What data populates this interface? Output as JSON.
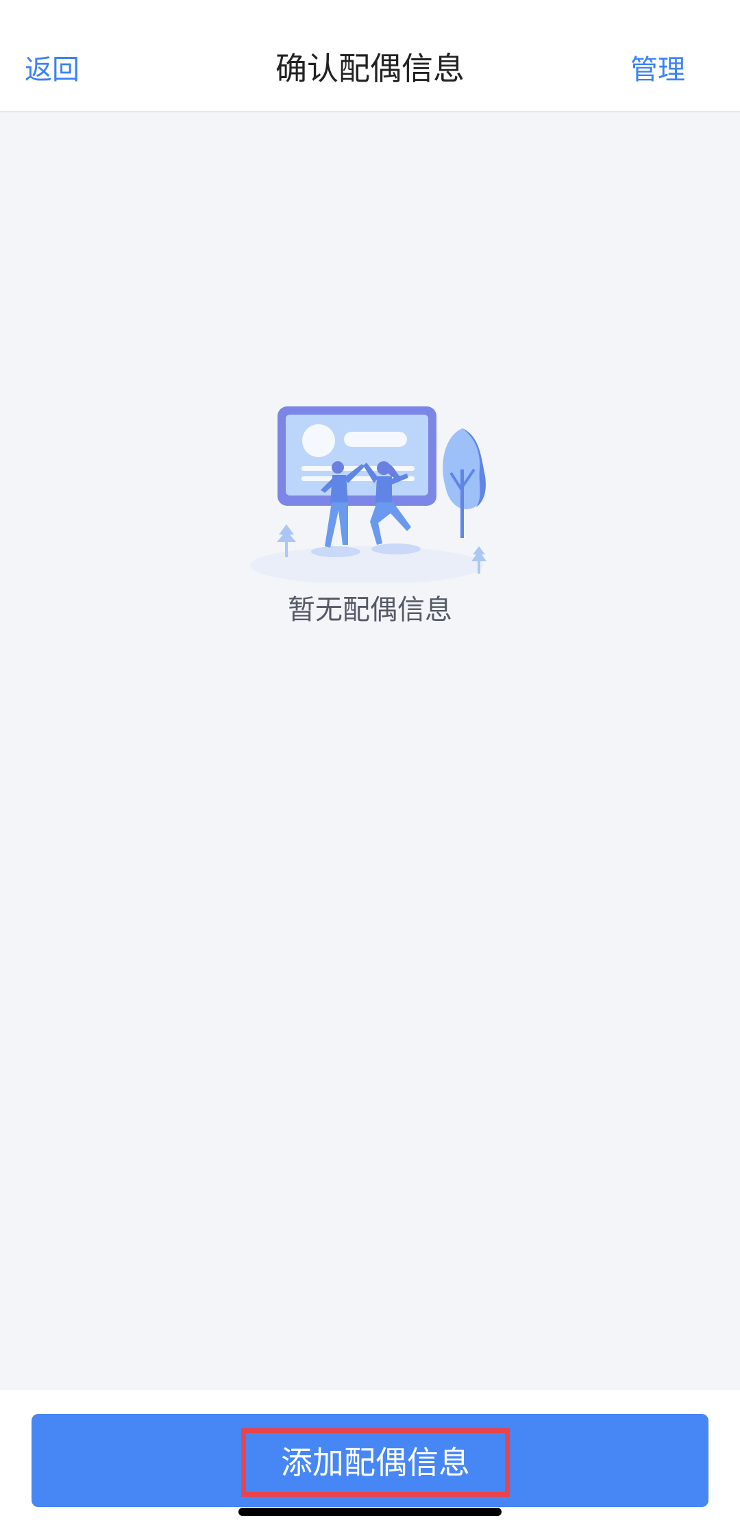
{
  "navbar": {
    "back_label": "返回",
    "title": "确认配偶信息",
    "manage_label": "管理"
  },
  "empty_state": {
    "message": "暂无配偶信息",
    "illustration": "people-high-five-illustration"
  },
  "footer": {
    "add_button_label": "添加配偶信息"
  },
  "colors": {
    "accent": "#3b82f6",
    "button": "#4687f5",
    "highlight_border": "#e8444b",
    "background": "#f3f5f9"
  }
}
